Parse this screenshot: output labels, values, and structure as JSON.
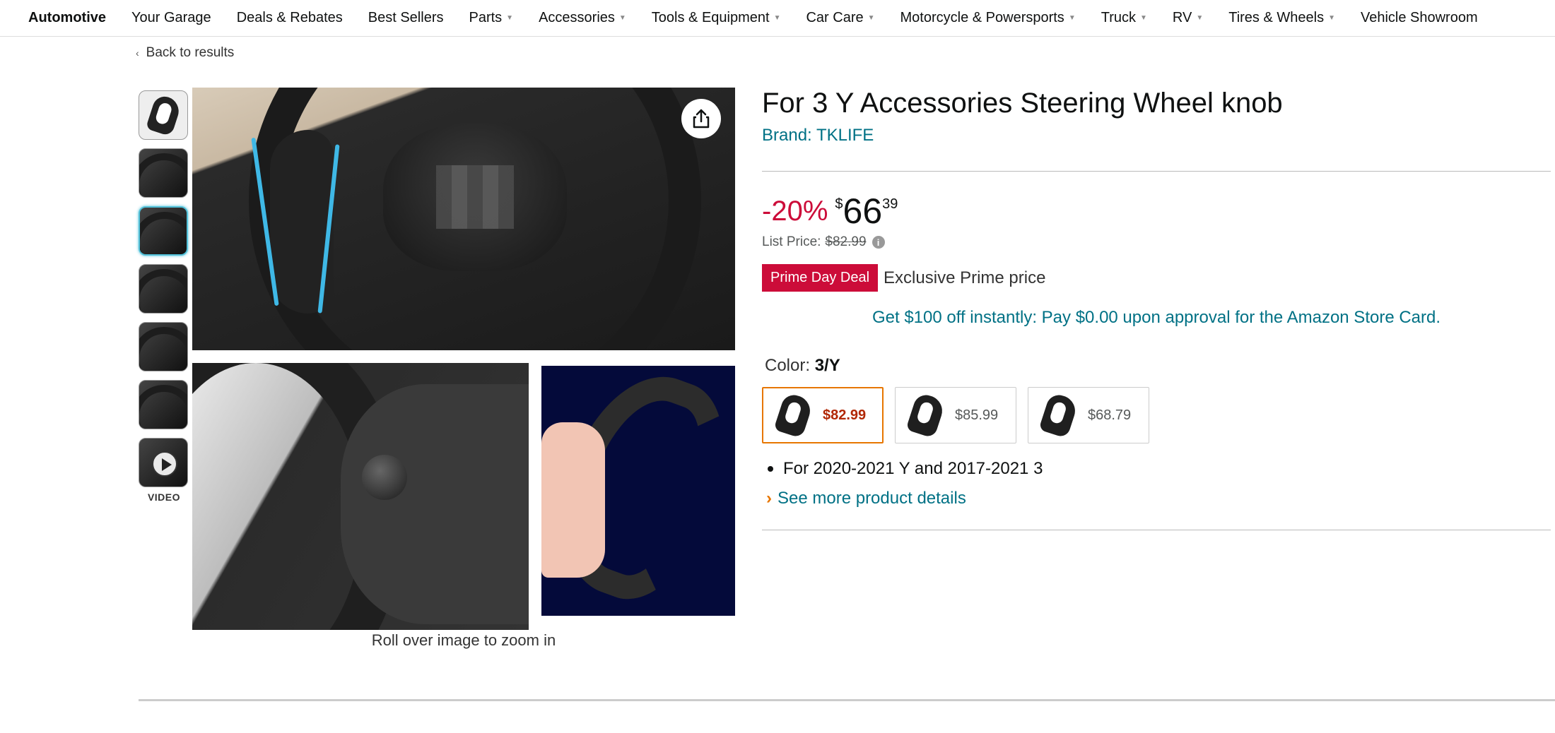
{
  "nav": {
    "items": [
      {
        "label": "Automotive",
        "bold": true,
        "caret": false
      },
      {
        "label": "Your Garage",
        "caret": false
      },
      {
        "label": "Deals & Rebates",
        "caret": false
      },
      {
        "label": "Best Sellers",
        "caret": false
      },
      {
        "label": "Parts",
        "caret": true
      },
      {
        "label": "Accessories",
        "caret": true
      },
      {
        "label": "Tools & Equipment",
        "caret": true
      },
      {
        "label": "Car Care",
        "caret": true
      },
      {
        "label": "Motorcycle & Powersports",
        "caret": true
      },
      {
        "label": "Truck",
        "caret": true
      },
      {
        "label": "RV",
        "caret": true
      },
      {
        "label": "Tires & Wheels",
        "caret": true
      },
      {
        "label": "Vehicle Showroom",
        "caret": false
      }
    ]
  },
  "back_link": "Back to results",
  "gallery": {
    "video_label": "VIDEO",
    "zoom_note": "Roll over image to zoom in"
  },
  "product": {
    "title": "For 3 Y Accessories Steering Wheel knob",
    "brand": "Brand: TKLIFE",
    "discount": "-20%",
    "currency": "$",
    "price_whole": "66",
    "price_fraction": "39",
    "list_price_label": "List Price:",
    "list_price": "$82.99",
    "deal_badge": "Prime Day Deal",
    "deal_text": "Exclusive Prime price",
    "promo": "Get $100 off instantly: Pay $0.00 upon approval for the Amazon Store Card.",
    "color_label": "Color: ",
    "color_value": "3/Y",
    "swatches": [
      {
        "price": "$82.99",
        "selected": true
      },
      {
        "price": "$85.99",
        "selected": false
      },
      {
        "price": "$68.79",
        "selected": false
      }
    ],
    "bullet": "For 2020-2021 Y and 2017-2021 3",
    "see_more": "See more product details"
  },
  "colors": {
    "link": "#007185",
    "deal_red": "#cc0c39",
    "selected_border": "#e77600",
    "thumb_active": "#52c1d9"
  }
}
